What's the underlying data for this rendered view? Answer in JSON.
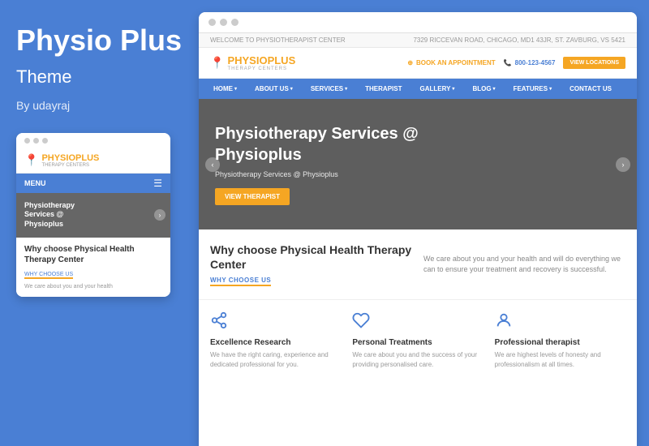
{
  "left": {
    "title": "Physio Plus",
    "subtitle": "Theme",
    "author": "By udayraj"
  },
  "mobile": {
    "logo_text": "PHYSIO",
    "logo_highlight": "PLUS",
    "logo_tagline": "THERAPY CENTERS",
    "menu_label": "MENU",
    "hero_text": "Physiotherapy\nServices @\nPhysioplus",
    "why_title": "Why choose Physical Health Therapy Center",
    "why_link": "WHY CHOOSE US",
    "body_text": "We care about you and your health"
  },
  "desktop": {
    "info_left": "WELCOME TO PHYSIOTHERAPIST CENTER",
    "info_right": "7329 RICCEVAN ROAD, CHICAGO, MD1 43JR, ST. ZAVBURG, VS 5421",
    "logo_text": "PHYSIO",
    "logo_highlight": "PLUS",
    "logo_tagline": "THERAPY CENTERS",
    "appointment_label": "BOOK AN APPOINTMENT",
    "phone": "800-123-4567",
    "view_locations": "VIEW LOCATIONS",
    "nav": [
      "HOME",
      "ABOUT US",
      "SERVICES",
      "THERAPIST",
      "GALLERY",
      "BLOG",
      "FEATURES",
      "CONTACT US"
    ],
    "hero_title": "Physiotherapy Services @ Physioplus",
    "hero_subtitle": "Physiotherapy Services @ Physioplus",
    "hero_btn": "VIEW THERAPIST",
    "why_title": "Why choose Physical Health Therapy Center",
    "why_link": "WHY CHOOSE US",
    "why_desc": "We care about you and your health and will do everything we can to ensure your treatment and recovery is successful.",
    "features": [
      {
        "icon": "share",
        "title": "Excellence Research",
        "text": "We have the right caring, experience and dedicated professional for you."
      },
      {
        "icon": "heart",
        "title": "Personal Treatments",
        "text": "We care about you and the success of your providing personalised care."
      },
      {
        "icon": "person",
        "title": "Professional therapist",
        "text": "We are highest levels of honesty and professionalism at all times."
      }
    ]
  }
}
